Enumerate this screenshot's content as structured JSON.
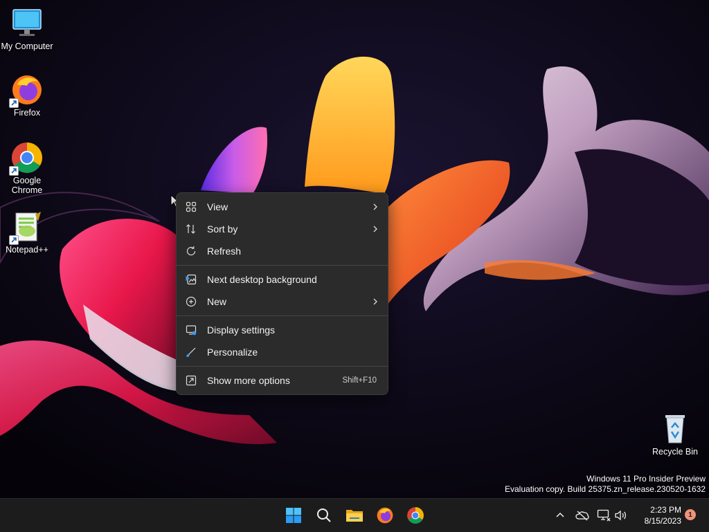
{
  "desktop": {
    "icons": [
      {
        "label": "My Computer"
      },
      {
        "label": "Firefox"
      },
      {
        "label": "Google Chrome"
      },
      {
        "label": "Notepad++"
      },
      {
        "label": "Recycle Bin"
      }
    ],
    "watermark": {
      "line1": "Windows 11 Pro Insider Preview",
      "line2": "Evaluation copy. Build 25375.zn_release.230520-1632"
    }
  },
  "context_menu": {
    "items": [
      {
        "label": "View",
        "icon": "grid-icon",
        "submenu": true
      },
      {
        "label": "Sort by",
        "icon": "sort-icon",
        "submenu": true
      },
      {
        "label": "Refresh",
        "icon": "refresh-icon",
        "submenu": false
      },
      {
        "label": "Next desktop background",
        "icon": "next-background-icon",
        "submenu": false
      },
      {
        "label": "New",
        "icon": "plus-circle-icon",
        "submenu": true
      },
      {
        "label": "Display settings",
        "icon": "display-settings-icon",
        "submenu": false
      },
      {
        "label": "Personalize",
        "icon": "brush-icon",
        "submenu": false
      },
      {
        "label": "Show more options",
        "icon": "more-options-icon",
        "shortcut": "Shift+F10",
        "submenu": false
      }
    ]
  },
  "taskbar": {
    "apps": [
      "start-icon",
      "search-icon",
      "file-explorer-icon",
      "firefox-icon",
      "chrome-icon"
    ],
    "clock": {
      "time": "2:23 PM",
      "date": "8/15/2023"
    },
    "notification_count": "1"
  },
  "colors": {
    "menu_bg": "#2b2b2b",
    "taskbar_bg": "#1c1c1c",
    "accent_blue": "#3a9bf0"
  }
}
